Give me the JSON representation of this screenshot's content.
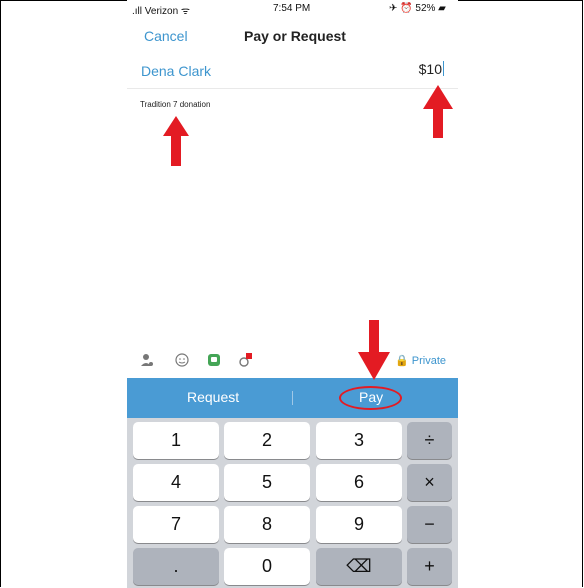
{
  "status_bar": {
    "carrier": ".ıll Verizon ᯤ",
    "time": "7:54 PM",
    "battery": "✈ ⏰ 52% ▰"
  },
  "nav": {
    "cancel": "Cancel",
    "title": "Pay or Request"
  },
  "recipient": "Dena Clark",
  "amount": "$10",
  "note": "Tradition 7 donation",
  "toolbar": {
    "icons": [
      "user-icon",
      "smile-icon",
      "sticker-icon",
      "camera-badge-icon"
    ],
    "privacy": "🔒 Private"
  },
  "actions": {
    "request": "Request",
    "pay": "Pay"
  },
  "keypad": [
    [
      "1",
      "2",
      "3",
      "÷"
    ],
    [
      "4",
      "5",
      "6",
      "×"
    ],
    [
      "7",
      "8",
      "9",
      "−"
    ],
    [
      ".",
      "0",
      "⌫",
      "+"
    ]
  ],
  "colors": {
    "accent": "#3d95ce",
    "action_bar": "#4a9bd4",
    "annotation": "#e31b23"
  }
}
